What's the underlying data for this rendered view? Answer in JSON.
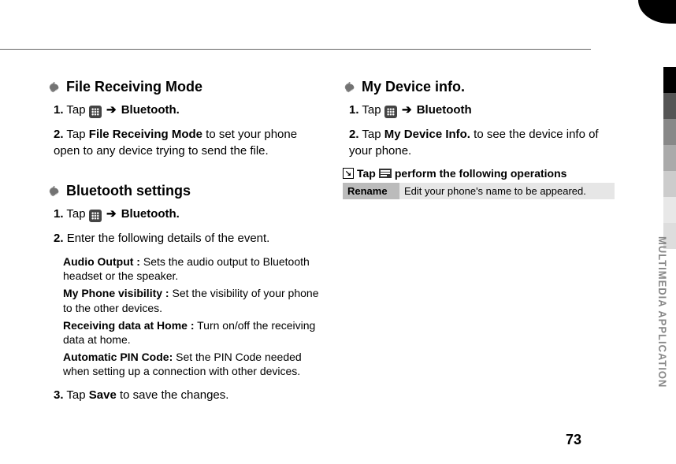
{
  "sideLabel": "MULTIMEDIA APPLICATION",
  "pageNumber": "73",
  "left": {
    "sec1": {
      "title": "File Receiving Mode",
      "step1_num": "1.",
      "step1_a": "Tap",
      "step1_arrow": "➔",
      "step1_b": "Bluetooth.",
      "step2_num": "2.",
      "step2_a": "Tap",
      "step2_b": "File Receiving Mode",
      "step2_c": "to set your phone open to any device trying to send the file."
    },
    "sec2": {
      "title": "Bluetooth settings",
      "step1_num": "1.",
      "step1_a": "Tap",
      "step1_arrow": "➔",
      "step1_b": "Bluetooth.",
      "step2_num": "2.",
      "step2_a": "Enter the following details of the event.",
      "d1_label": "Audio Output :",
      "d1_body": "Sets the audio output to Bluetooth headset or the speaker.",
      "d2_label": "My Phone visibility  :",
      "d2_body": "Set the visibility of your phone to the other devices.",
      "d3_label": "Receiving data at Home :",
      "d3_body": "Turn on/off the receiving data at home.",
      "d4_label": "Automatic PIN Code:",
      "d4_body": "Set the PIN Code needed when setting up a connection with other devices.",
      "step3_num": "3.",
      "step3_a": "Tap",
      "step3_b": "Save",
      "step3_c": "to save the changes."
    }
  },
  "right": {
    "sec1": {
      "title": "My Device info.",
      "step1_num": "1.",
      "step1_a": "Tap",
      "step1_arrow": "➔",
      "step1_b": "Bluetooth",
      "step2_num": "2.",
      "step2_a": "Tap",
      "step2_b": "My Device Info.",
      "step2_c": "to see the device info of your phone."
    },
    "tip": {
      "pre": "Tap",
      "post": "perform the following operations",
      "table_h": "Rename",
      "table_d": "Edit your phone's name to be appeared."
    }
  }
}
